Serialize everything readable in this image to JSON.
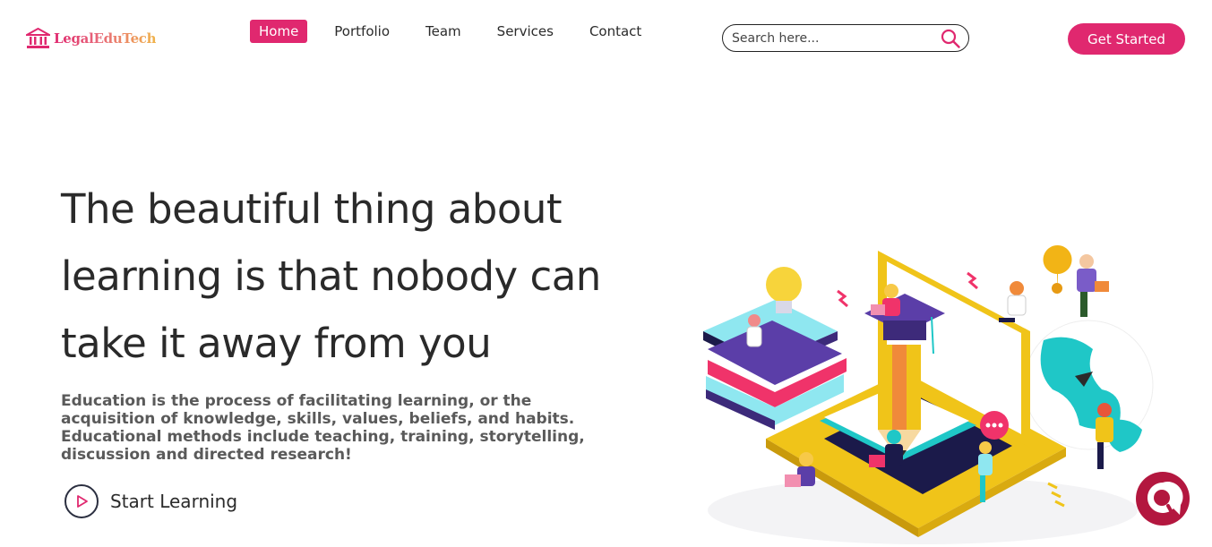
{
  "brand": {
    "name": "LegalEduTech",
    "logo_icon": "courthouse-icon",
    "accent": "#e0286f"
  },
  "nav": {
    "items": [
      {
        "label": "Home",
        "active": true
      },
      {
        "label": "Portfolio",
        "active": false
      },
      {
        "label": "Team",
        "active": false
      },
      {
        "label": "Services",
        "active": false
      },
      {
        "label": "Contact",
        "active": false
      }
    ]
  },
  "search": {
    "placeholder": "Search here...",
    "value": "",
    "icon": "search-icon"
  },
  "header": {
    "cta_label": "Get Started"
  },
  "hero": {
    "title": "The beautiful thing about learning is that nobody can take it away from you",
    "description": "Education is the process of facilitating learning, or the acquisition of knowledge, skills, values, beliefs, and habits. Educational methods include teaching, training, storytelling, discussion and directed research!",
    "cta_label": "Start Learning",
    "cta_icon": "play-icon",
    "illustration": "education-isometric-illustration"
  },
  "chat_widget": {
    "icon": "chat-bubble-icon",
    "color": "#b3173f"
  }
}
